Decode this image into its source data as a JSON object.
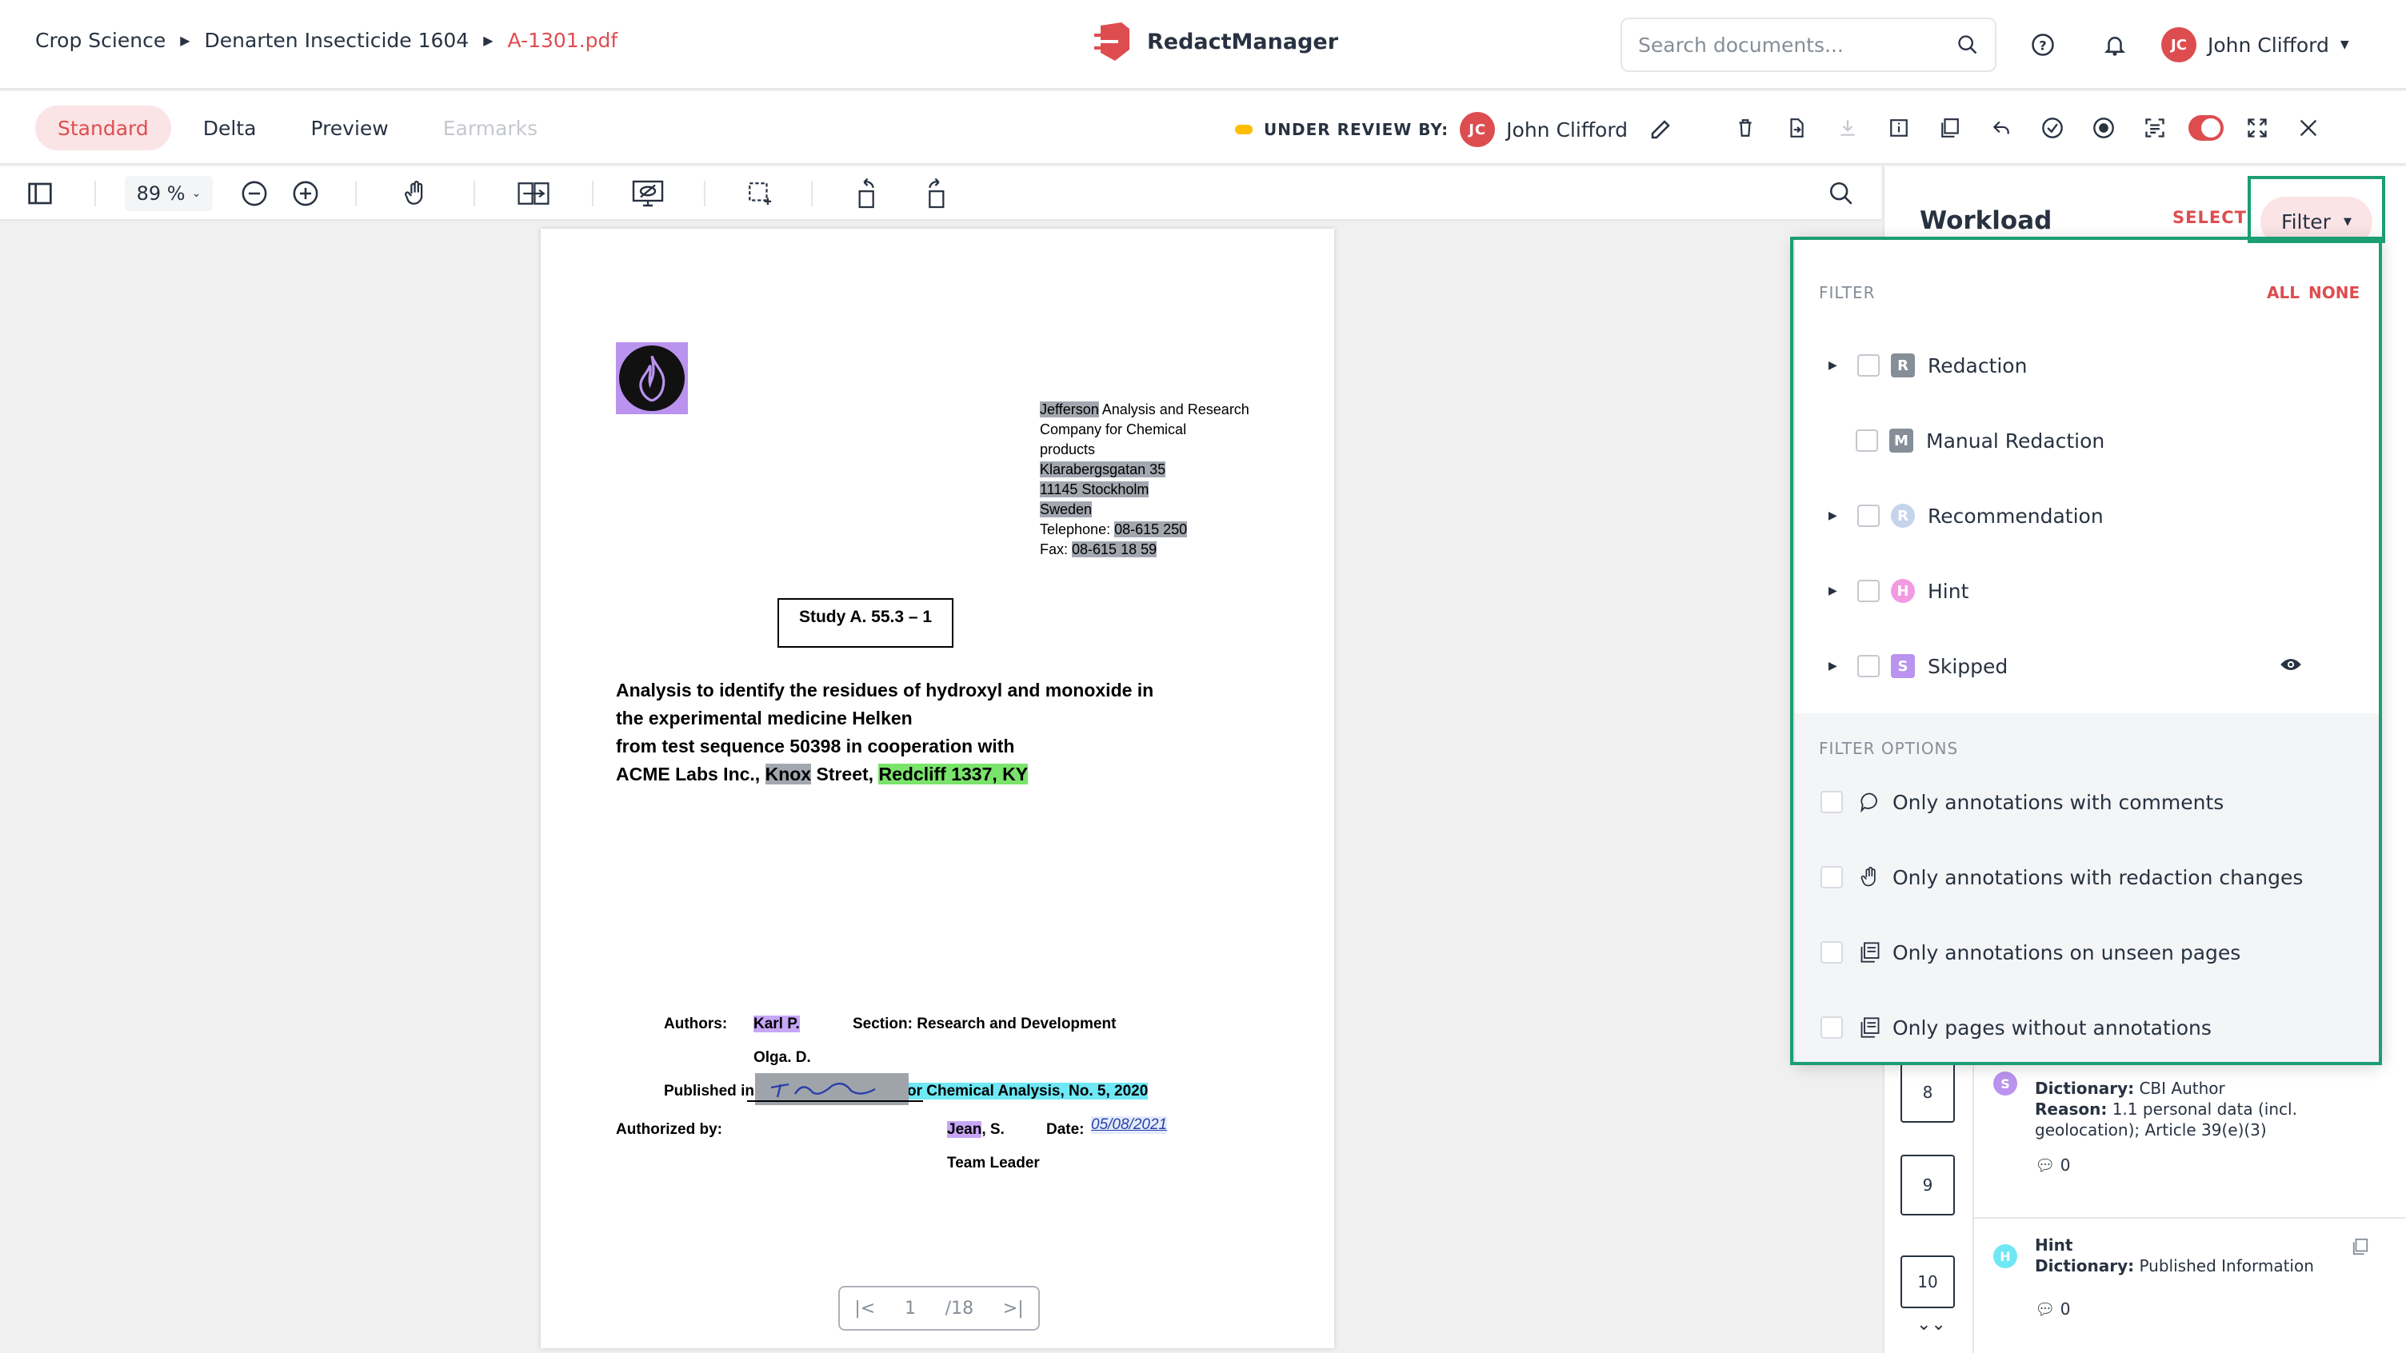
{
  "breadcrumb": {
    "items": [
      "Crop Science",
      "Denarten Insecticide 1604",
      "A-1301.pdf"
    ]
  },
  "brand": {
    "name": "RedactManager",
    "color": "#dd4d50"
  },
  "search": {
    "placeholder": "Search documents..."
  },
  "user": {
    "initials": "JC",
    "name": "John Clifford"
  },
  "views": {
    "tabs": [
      {
        "label": "Standard",
        "active": true
      },
      {
        "label": "Delta",
        "active": false
      },
      {
        "label": "Preview",
        "active": false
      },
      {
        "label": "Earmarks",
        "disabled": true
      }
    ]
  },
  "review": {
    "status": "UNDER REVIEW BY:",
    "initials": "JC",
    "name": "John Clifford",
    "status_color": "#fdbd00"
  },
  "toolbar": {
    "zoom": "89 %"
  },
  "document": {
    "address": {
      "line1_hl": "Jefferson",
      "line1_rest": " Analysis and Research",
      "line2": "Company for Chemical",
      "line3": "products",
      "street": "Klarabergsgatan 35",
      "city": "11145 Stockholm",
      "country": "Sweden",
      "tel_label": "Telephone: ",
      "tel": "08-615 250",
      "fax_label": "Fax: ",
      "fax": "08-615 18 59"
    },
    "study": "Study A. 55.3 – 1",
    "title": {
      "l1": "Analysis to identify the residues of hydroxyl and monoxide in",
      "l2": "the experimental medicine Helken",
      "l3": "from test sequence 50398 in cooperation with",
      "l4a": "ACME Labs Inc., ",
      "l4b": "Knox",
      "l4c": " Street, ",
      "l4d": "Redcliff 1337, KY"
    },
    "authors_label": "Authors:",
    "author1": "Karl P.",
    "author2": "Olga. D.",
    "section": "Section: Research and Development",
    "published_label": "Published in:",
    "published": "Readen – Journal for Chemical Analysis, No. 5, 2020",
    "authorized_label": "Authorized by:",
    "signature_text": "J. Smith",
    "jean": "Jean",
    "jean_rest": ", S.",
    "date_label": "Date:",
    "date": "05/08/2021",
    "role": "Team Leader",
    "page_current": "1",
    "page_total": "/18"
  },
  "workload": {
    "title": "Workload",
    "select": "SELECT",
    "filter_button": "Filter"
  },
  "filter": {
    "heading": "FILTER",
    "all": "ALL",
    "none": "NONE",
    "items": [
      {
        "label": "Redaction",
        "badge": "R",
        "badge_color": "#868e98",
        "shape": "square",
        "expandable": true
      },
      {
        "label": "Manual Redaction",
        "badge": "M",
        "badge_color": "#868e98",
        "shape": "square",
        "expandable": false
      },
      {
        "label": "Recommendation",
        "badge": "R",
        "badge_color": "#c5d3eb",
        "shape": "round",
        "expandable": true
      },
      {
        "label": "Hint",
        "badge": "H",
        "badge_color": "#f29ae1",
        "shape": "round",
        "expandable": true
      },
      {
        "label": "Skipped",
        "badge": "S",
        "badge_color": "#b993ee",
        "shape": "square",
        "expandable": true
      }
    ],
    "options_heading": "FILTER OPTIONS",
    "options": [
      {
        "label": "Only annotations with comments",
        "icon": "comment-icon"
      },
      {
        "label": "Only annotations with redaction changes",
        "icon": "hand-icon"
      },
      {
        "label": "Only annotations on unseen pages",
        "icon": "pages-icon"
      },
      {
        "label": "Only pages without annotations",
        "icon": "pages-icon"
      }
    ]
  },
  "thumbnails": [
    "8",
    "9",
    "10"
  ],
  "annotations": [
    {
      "badge": "S",
      "badge_color": "#b993ee",
      "type": "Skipped",
      "dict_label": "Dictionary:",
      "dict": "CBI Author",
      "reason_label": "Reason:",
      "reason1": "1.1 personal data (incl.",
      "reason2": "geolocation); Article 39(e)(3)",
      "comments": "0"
    },
    {
      "badge": "H",
      "badge_color": "#6fe7f4",
      "type": "Hint",
      "dict_label": "Dictionary:",
      "dict": "Published Information",
      "comments": "0"
    }
  ]
}
